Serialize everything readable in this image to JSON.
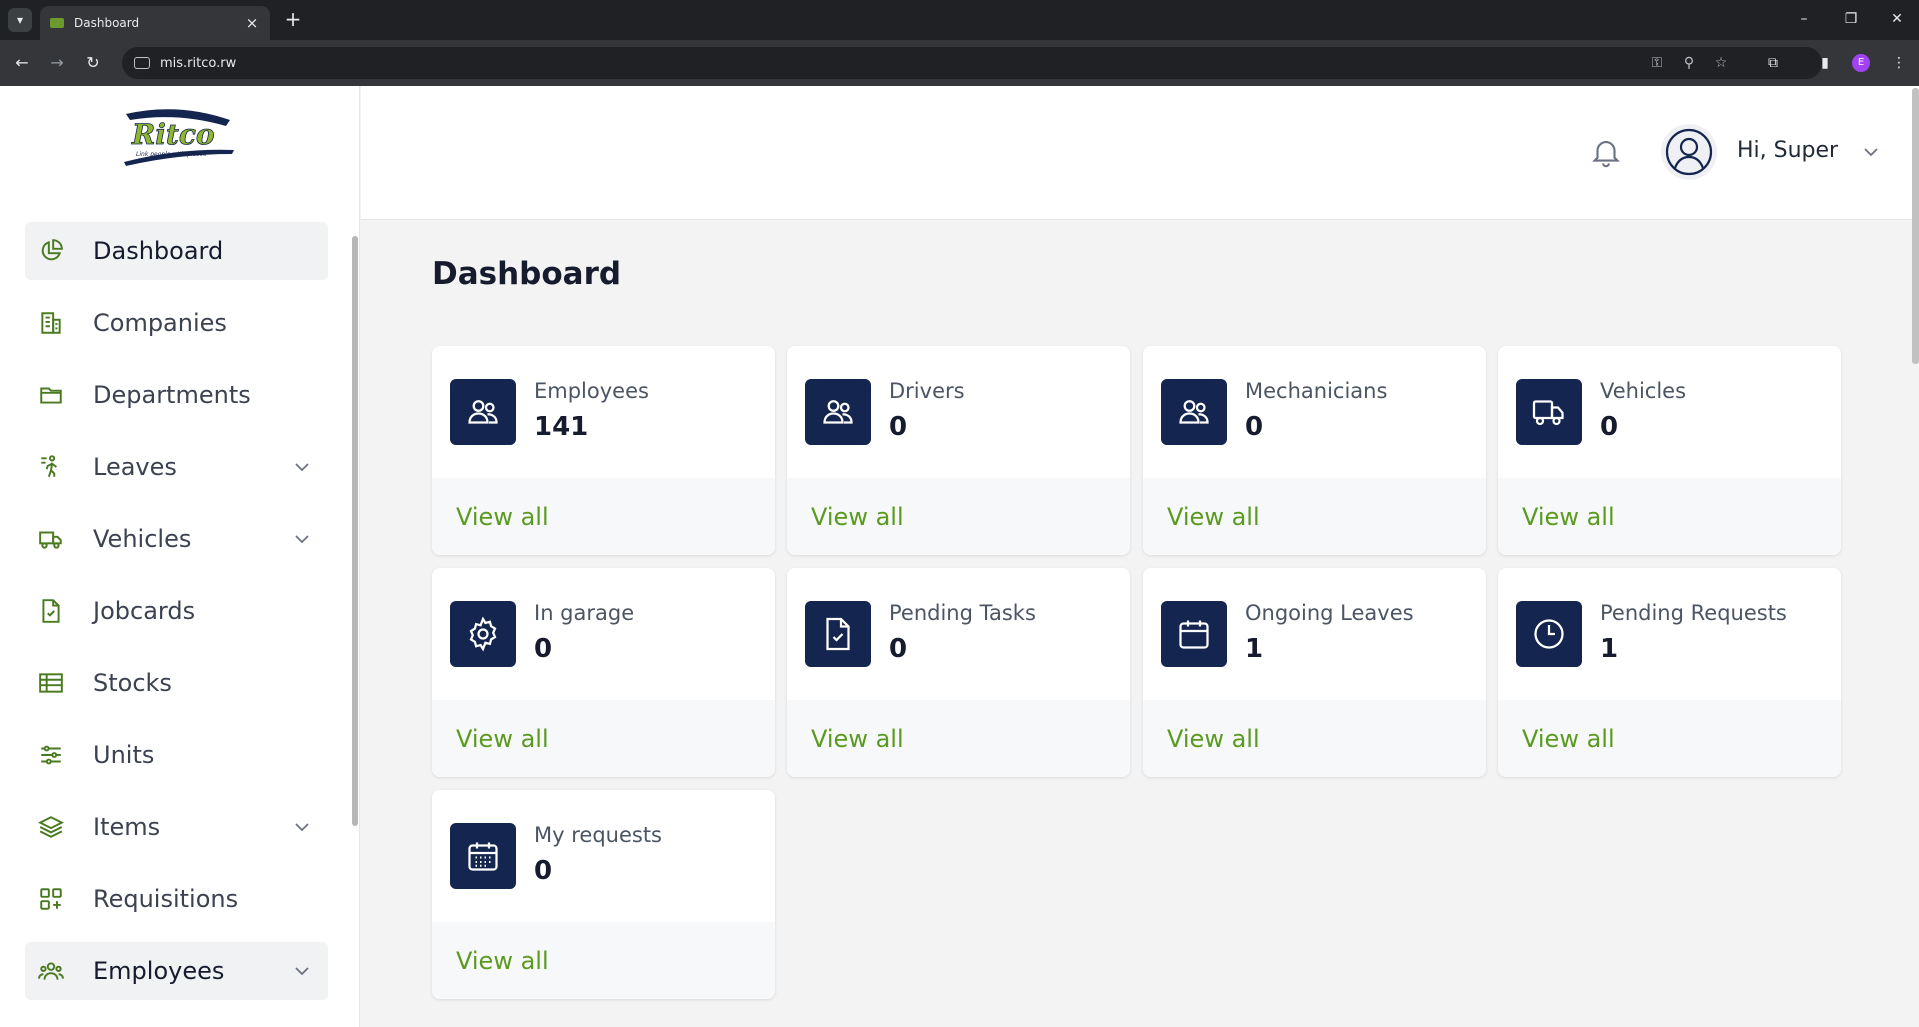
{
  "browser": {
    "tab_title": "Dashboard",
    "url": "mis.ritco.rw",
    "profile_initial": "E"
  },
  "sidebar": {
    "logo_text": "Ritco",
    "logo_tagline": "Link people with places",
    "items": [
      {
        "label": "Dashboard",
        "icon": "pie-chart-icon",
        "active": true,
        "expandable": false
      },
      {
        "label": "Companies",
        "icon": "building-icon",
        "active": false,
        "expandable": false
      },
      {
        "label": "Departments",
        "icon": "folder-icon",
        "active": false,
        "expandable": false
      },
      {
        "label": "Leaves",
        "icon": "walking-person-icon",
        "active": false,
        "expandable": true
      },
      {
        "label": "Vehicles",
        "icon": "truck-icon",
        "active": false,
        "expandable": true
      },
      {
        "label": "Jobcards",
        "icon": "file-check-icon",
        "active": false,
        "expandable": false
      },
      {
        "label": "Stocks",
        "icon": "table-icon",
        "active": false,
        "expandable": false
      },
      {
        "label": "Units",
        "icon": "sliders-icon",
        "active": false,
        "expandable": false
      },
      {
        "label": "Items",
        "icon": "layers-icon",
        "active": false,
        "expandable": true
      },
      {
        "label": "Requisitions",
        "icon": "grid-plus-icon",
        "active": false,
        "expandable": false
      },
      {
        "label": "Employees",
        "icon": "users-icon",
        "active": true,
        "expandable": true
      }
    ]
  },
  "header": {
    "greeting": "Hi, Super"
  },
  "main": {
    "title": "Dashboard",
    "cards": [
      {
        "label": "Employees",
        "value": "141",
        "link": "View all",
        "icon": "users-icon"
      },
      {
        "label": "Drivers",
        "value": "0",
        "link": "View all",
        "icon": "users-icon"
      },
      {
        "label": "Mechanicians",
        "value": "0",
        "link": "View all",
        "icon": "users-icon"
      },
      {
        "label": "Vehicles",
        "value": "0",
        "link": "View all",
        "icon": "truck-icon"
      },
      {
        "label": "In garage",
        "value": "0",
        "link": "View all",
        "icon": "gear-icon"
      },
      {
        "label": "Pending Tasks",
        "value": "0",
        "link": "View all",
        "icon": "file-check-icon"
      },
      {
        "label": "Ongoing Leaves",
        "value": "1",
        "link": "View all",
        "icon": "calendar-icon"
      },
      {
        "label": "Pending Requests",
        "value": "1",
        "link": "View all",
        "icon": "clock-icon"
      },
      {
        "label": "My requests",
        "value": "0",
        "link": "View all",
        "icon": "calendar-grid-icon"
      }
    ]
  },
  "colors": {
    "accent_green": "#5a9a1f",
    "icon_navy": "#14254f",
    "sidebar_icon_green": "#4a7a20"
  }
}
